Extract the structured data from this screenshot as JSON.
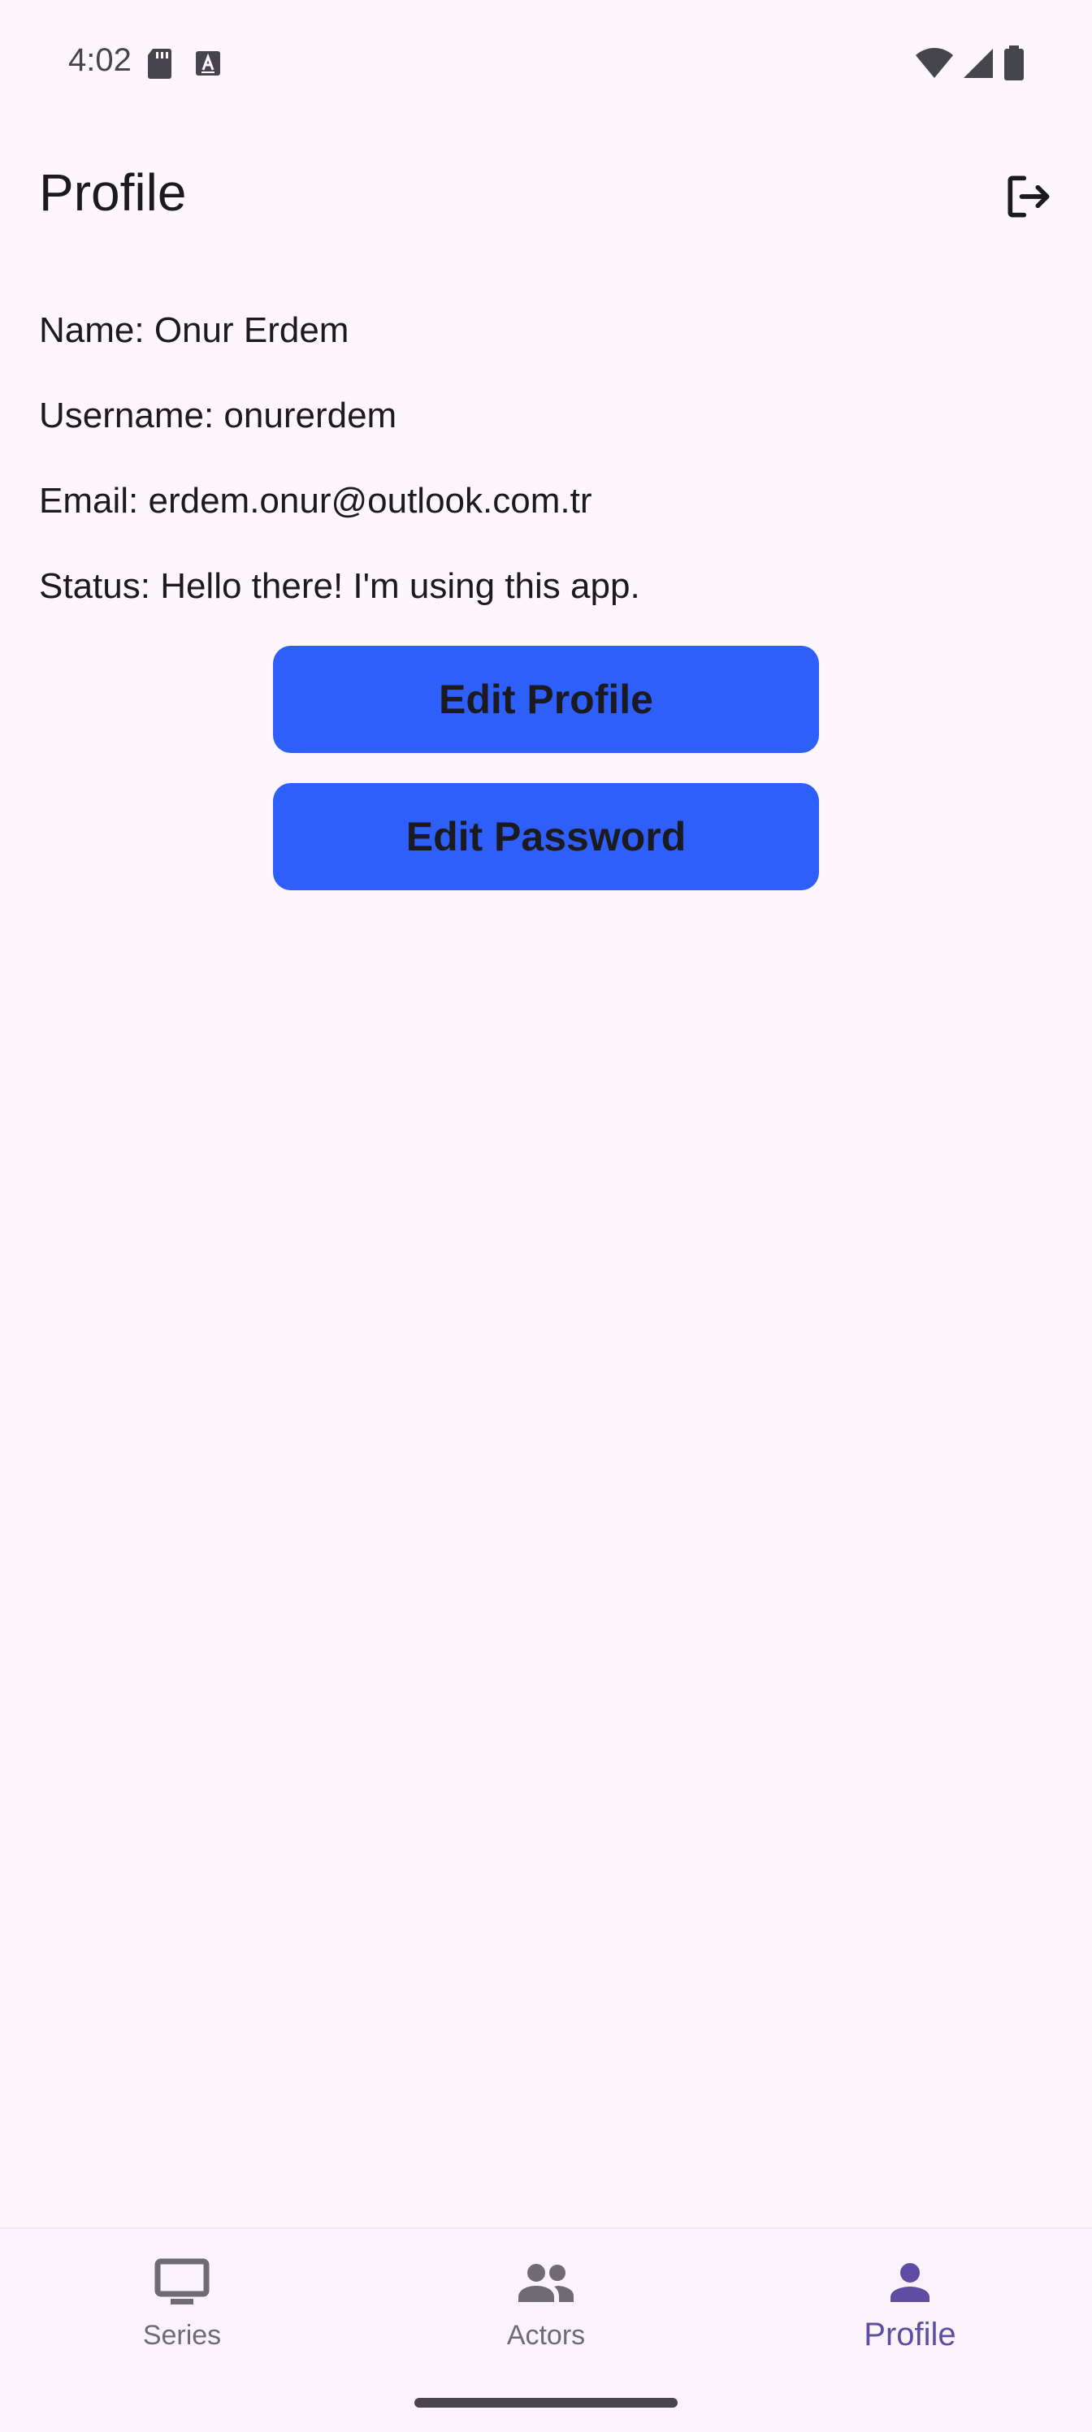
{
  "status_bar": {
    "time": "4:02",
    "icons": [
      "sd-card-icon",
      "text-a-icon",
      "wifi-icon",
      "cellular-signal-icon",
      "battery-icon"
    ]
  },
  "app_bar": {
    "title": "Profile",
    "logout_icon": "logout-icon"
  },
  "profile": {
    "name": "Name: Onur Erdem",
    "username": "Username: onurerdem",
    "email": "Email: erdem.onur@outlook.com.tr",
    "status": "Status: Hello there! I'm using this app."
  },
  "actions": {
    "edit_profile": "Edit Profile",
    "edit_password": "Edit Password",
    "button_color": "#2f5ffa"
  },
  "bottom_nav": {
    "items": [
      {
        "label": "Series",
        "icon": "tv-icon",
        "active": false
      },
      {
        "label": "Actors",
        "icon": "people-icon",
        "active": false
      },
      {
        "label": "Profile",
        "icon": "person-icon",
        "active": true
      }
    ],
    "active_color": "#5d4ea3"
  }
}
